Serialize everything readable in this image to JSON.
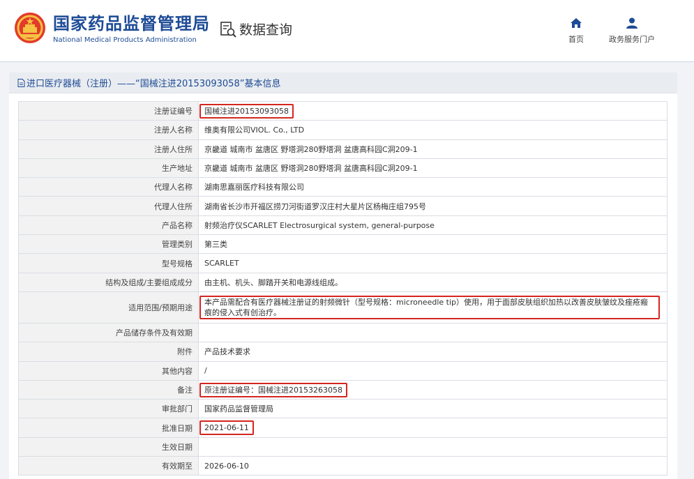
{
  "header": {
    "org_cn": "国家药品监督管理局",
    "org_en": "National Medical Products Administration",
    "query_label": "数据查询",
    "nav": {
      "home": "首页",
      "portal": "政务服务门户"
    }
  },
  "panel": {
    "title": "进口医疗器械（注册）——“国械注进20153093058”基本信息"
  },
  "rows": [
    {
      "label": "注册证编号",
      "value": "国械注进20153093058"
    },
    {
      "label": "注册人名称",
      "value": "维奥有限公司VIOL. Co., LTD"
    },
    {
      "label": "注册人住所",
      "value": "京畿道 城南市 盆唐区 野塔洞280野塔洞 盆唐高科园C洞209-1"
    },
    {
      "label": "生产地址",
      "value": "京畿道 城南市 盆唐区 野塔洞280野塔洞 盆唐高科园C洞209-1"
    },
    {
      "label": "代理人名称",
      "value": "湖南思嘉丽医疗科技有限公司"
    },
    {
      "label": "代理人住所",
      "value": "湖南省长沙市开福区捞刀河街道罗汉庄村大星片区杨梅庄组795号"
    },
    {
      "label": "产品名称",
      "value": "射频治疗仪SCARLET Electrosurgical system, general-purpose"
    },
    {
      "label": "管理类别",
      "value": "第三类"
    },
    {
      "label": "型号规格",
      "value": "SCARLET"
    },
    {
      "label": "结构及组成/主要组成成分",
      "value": "由主机、机头、脚踏开关和电源线组成。"
    },
    {
      "label": "适用范围/预期用途",
      "value": "本产品需配合有医疗器械注册证的射频微针（型号规格：microneedle tip）使用，用于面部皮肤组织加热以改善皮肤皱纹及痤疮瘢痕的侵入式有创治疗。"
    },
    {
      "label": "产品储存条件及有效期",
      "value": ""
    },
    {
      "label": "附件",
      "value": "产品技术要求"
    },
    {
      "label": "其他内容",
      "value": "/"
    },
    {
      "label": "备注",
      "value": "原注册证编号：国械注进20153263058"
    },
    {
      "label": "审批部门",
      "value": "国家药品监督管理局"
    },
    {
      "label": "批准日期",
      "value": "2021-06-11"
    },
    {
      "label": "生效日期",
      "value": ""
    },
    {
      "label": "有效期至",
      "value": "2026-06-10"
    }
  ],
  "colors": {
    "brand_blue": "#1d4b96",
    "highlight_red": "#d42620",
    "label_bg": "#f2f2f2"
  },
  "icons": {
    "emblem": "national-emblem-icon",
    "query": "data-query-icon",
    "home": "home-icon",
    "portal": "user-icon",
    "doc": "document-icon"
  }
}
